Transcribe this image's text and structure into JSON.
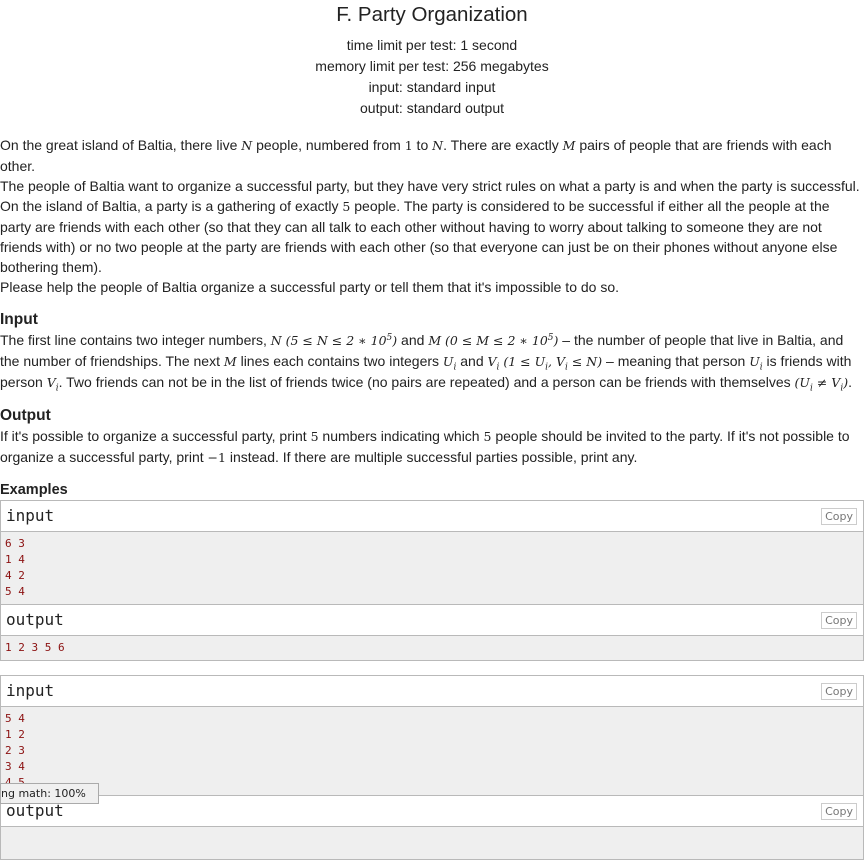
{
  "problem": {
    "title": "F. Party Organization",
    "limits": [
      "time limit per test: 1 second",
      "memory limit per test: 256 megabytes",
      "input: standard input",
      "output: standard output"
    ]
  },
  "statement": {
    "p1": {
      "a": "On the great island of Baltia, there live ",
      "N": "N",
      "b": " people, numbered from ",
      "one": "1",
      "c": " to ",
      "N2": "N",
      "d": ". There are exactly ",
      "M": "M",
      "e": " pairs of people that are friends with each other."
    },
    "p2": "The people of Baltia want to organize a successful party, but they have very strict rules on what a party is and when the party is successful.",
    "p3": {
      "a": "On the island of Baltia, a party is a gathering of exactly ",
      "five": "5",
      "b": " people. The party is considered to be successful if either all the people at the party are friends with each other (so that they can all talk to each other without having to worry about talking to someone they are not friends with) or no two people at the party are friends with each other (so that everyone can just be on their phones without anyone else bothering them)."
    },
    "p4": "Please help the people of Baltia organize a successful party or tell them that it's impossible to do so."
  },
  "input_section": {
    "title": "Input",
    "t1": "The first line contains two integer numbers, ",
    "t2": " and ",
    "t3": " – the number of people that live in Baltia, and the number of friendships. The next ",
    "t4": " lines each contains two integers ",
    "t5": " and ",
    "t6": " – meaning that person ",
    "t7": " is friends with person ",
    "t8": ". Two friends can not be in the list of friends twice (no pairs are repeated) and a person can be friends with themselves ",
    "t9": ".",
    "N": "N",
    "M": "M",
    "U": "U",
    "V": "V",
    "i": "i",
    "n_constraint": "(5 ≤ N ≤ 2 ∗ 10",
    "m_constraint": "(0 ≤ M ≤ 2 ∗ 10",
    "exp": "5",
    "close": ")",
    "uv_open": "(1 ≤ U",
    "uv_mid": ", V",
    "uv_close": " ≤ N)",
    "neq_open": "(U",
    "neq_mid": " ≠ V",
    "neq_close": ")"
  },
  "output_section": {
    "title": "Output",
    "a": "If it's possible to organize a successful party, print ",
    "five": "5",
    "b": " numbers indicating which ",
    "five2": "5",
    "c": " people should be invited to the party. If it's not possible to organize a successful party, print ",
    "neg1": "−1",
    "d": " instead. If there are multiple successful parties possible, print any."
  },
  "examples": {
    "title": "Examples",
    "copy_label": "Copy",
    "input_label": "input",
    "output_label": "output",
    "samples": [
      {
        "input": [
          "6 3",
          "1 4",
          "4 2",
          "5 4"
        ],
        "output": [
          "1 2 3 5 6"
        ]
      },
      {
        "input": [
          "5 4",
          "1 2",
          "2 3",
          "3 4",
          "4 5"
        ],
        "output": []
      }
    ]
  },
  "status": {
    "text": "ng math: 100%"
  }
}
